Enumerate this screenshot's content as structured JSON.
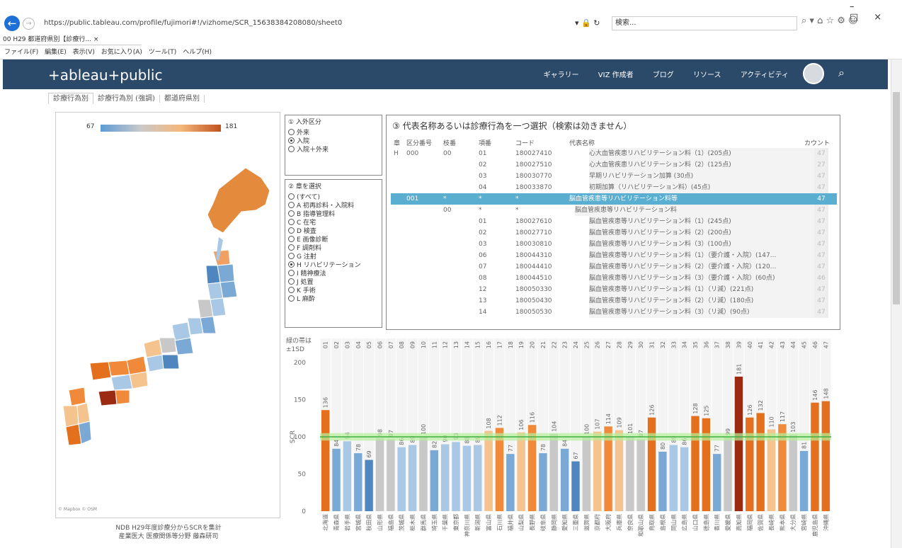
{
  "browser": {
    "url": "https://public.tableau.com/profile/fujimori#!/vizhome/SCR_15638384208080/sheet0",
    "search_placeholder": "検索...",
    "tab_title": "00 H29 都道府県別【診療行...",
    "menu": [
      "ファイル(F)",
      "編集(E)",
      "表示(V)",
      "お気に入り(A)",
      "ツール(T)",
      "ヘルプ(H)"
    ]
  },
  "tableau_nav": {
    "logo": "+ableau+public",
    "links": [
      "ギャラリー",
      "VIZ 作成者",
      "ブログ",
      "リソース",
      "アクティビティ"
    ]
  },
  "viz_tabs": [
    "診療行為別",
    "診療行為別 (強調)",
    "都道府県別"
  ],
  "map": {
    "legend_min": "67",
    "legend_max": "181",
    "attribution": "© Mapbox © OSM",
    "note_line1": "NDB H29年度診療分からSCRを集計",
    "note_line2": "産業医大 医療関係等分野 藤森研司"
  },
  "panel1": {
    "title": "① 入外区分",
    "options": [
      "外来",
      "入院",
      "入院＋外来"
    ],
    "selected": 1
  },
  "panel2": {
    "title": "② 章を選択",
    "options": [
      "(すべて)",
      "A 初再診料・入院料",
      "B 指導管理料",
      "C 在宅",
      "D 検査",
      "E 画像診断",
      "F 調剤料",
      "G 注射",
      "H リハビリテーション",
      "I 精神療法",
      "J 処置",
      "K 手術",
      "L 麻酔"
    ],
    "selected": 8
  },
  "panel3": {
    "title": "③ 代表名称あるいは診療行為を一つ選択（検索は効きません）",
    "headers": [
      "章",
      "区分番号",
      "枝番",
      "項番",
      "コード",
      "代表名称",
      "カウント"
    ],
    "rows": [
      {
        "ch": "H",
        "kubun": "000",
        "eda": "00",
        "kou": "01",
        "code": "180027410",
        "name": "心大血管疾患リハビリテーション料（1）(205点)",
        "cnt": "47"
      },
      {
        "ch": "",
        "kubun": "",
        "eda": "",
        "kou": "02",
        "code": "180027510",
        "name": "心大血管疾患リハビリテーション料（2）(125点)",
        "cnt": "27"
      },
      {
        "ch": "",
        "kubun": "",
        "eda": "",
        "kou": "03",
        "code": "180030770",
        "name": "早期リハビリテーション加算 (30点)",
        "cnt": "47"
      },
      {
        "ch": "",
        "kubun": "",
        "eda": "",
        "kou": "04",
        "code": "180033870",
        "name": "初期加算（リハビリテーション料）(45点)",
        "cnt": "47"
      },
      {
        "ch": "",
        "kubun": "001",
        "eda": "*",
        "kou": "*",
        "code": "*",
        "name": "脳血管疾患等リハビリテーション料等",
        "cnt": "47",
        "hl": true
      },
      {
        "ch": "",
        "kubun": "",
        "eda": "00",
        "kou": "*",
        "code": "*",
        "name": "脳血管疾患等リハビリテーション料",
        "cnt": "47"
      },
      {
        "ch": "",
        "kubun": "",
        "eda": "",
        "kou": "01",
        "code": "180027610",
        "name": "脳血管疾患等リハビリテーション料（1）(245点)",
        "cnt": "47"
      },
      {
        "ch": "",
        "kubun": "",
        "eda": "",
        "kou": "02",
        "code": "180027710",
        "name": "脳血管疾患等リハビリテーション料（2）(200点)",
        "cnt": "47"
      },
      {
        "ch": "",
        "kubun": "",
        "eda": "",
        "kou": "03",
        "code": "180030810",
        "name": "脳血管疾患等リハビリテーション料（3）(100点)",
        "cnt": "47"
      },
      {
        "ch": "",
        "kubun": "",
        "eda": "",
        "kou": "06",
        "code": "180044310",
        "name": "脳血管疾患等リハビリテーション料（1）（要介護・入院）(147...",
        "cnt": "47"
      },
      {
        "ch": "",
        "kubun": "",
        "eda": "",
        "kou": "07",
        "code": "180044410",
        "name": "脳血管疾患等リハビリテーション料（2）（要介護・入院）(120...",
        "cnt": "47"
      },
      {
        "ch": "",
        "kubun": "",
        "eda": "",
        "kou": "08",
        "code": "180044510",
        "name": "脳血管疾患等リハビリテーション料（3）（要介護・入院）(60点)",
        "cnt": "46"
      },
      {
        "ch": "",
        "kubun": "",
        "eda": "",
        "kou": "12",
        "code": "180050330",
        "name": "脳血管疾患等リハビリテーション料（1）（リ減）(221点)",
        "cnt": "47"
      },
      {
        "ch": "",
        "kubun": "",
        "eda": "",
        "kou": "13",
        "code": "180050430",
        "name": "脳血管疾患等リハビリテーション料（2）（リ減）(180点)",
        "cnt": "47"
      },
      {
        "ch": "",
        "kubun": "",
        "eda": "",
        "kou": "14",
        "code": "180050530",
        "name": "脳血管疾患等リハビリテーション料（3）（リ減）(90点)",
        "cnt": "47"
      }
    ]
  },
  "chart_data": {
    "type": "bar",
    "band_label_line1": "緑の帯は",
    "band_label_line2": "±1SD",
    "ylabel": "SCR",
    "ylim": [
      0,
      200
    ],
    "yticks": [
      0,
      50,
      100,
      150,
      200
    ],
    "codes": [
      "01",
      "02",
      "03",
      "04",
      "05",
      "06",
      "07",
      "08",
      "09",
      "10",
      "11",
      "12",
      "13",
      "14",
      "15",
      "16",
      "17",
      "18",
      "19",
      "20",
      "21",
      "22",
      "23",
      "24",
      "25",
      "26",
      "27",
      "28",
      "29",
      "30",
      "31",
      "32",
      "33",
      "34",
      "35",
      "36",
      "37",
      "38",
      "39",
      "40",
      "41",
      "42",
      "43",
      "44",
      "45",
      "46",
      "47"
    ],
    "categories": [
      "北海道",
      "青森県",
      "岩手県",
      "宮城県",
      "秋田県",
      "山形県",
      "福島県",
      "茨城県",
      "栃木県",
      "群馬県",
      "埼玉県",
      "千葉県",
      "東京都",
      "神奈川県",
      "新潟県",
      "富山県",
      "石川県",
      "福井県",
      "山梨県",
      "長野県",
      "岐阜県",
      "静岡県",
      "愛知県",
      "三重県",
      "滋賀県",
      "京都府",
      "大阪府",
      "兵庫県",
      "奈良県",
      "和歌山県",
      "鳥取県",
      "島根県",
      "岡山県",
      "広島県",
      "山口県",
      "徳島県",
      "香川県",
      "愛媛県",
      "高知県",
      "福岡県",
      "佐賀県",
      "長崎県",
      "熊本県",
      "大分県",
      "宮崎県",
      "鹿児島県",
      "沖縄県"
    ],
    "values": [
      136,
      84,
      94,
      78,
      69,
      98,
      97,
      86,
      89,
      100,
      82,
      90,
      93,
      88,
      89,
      108,
      112,
      77,
      106,
      116,
      78,
      104,
      84,
      67,
      100,
      107,
      114,
      109,
      101,
      97,
      126,
      80,
      89,
      86,
      128,
      125,
      77,
      99,
      181,
      126,
      132,
      110,
      117,
      103,
      81,
      146,
      148
    ],
    "band": [
      95,
      105
    ],
    "colors": {
      "dark_blue": "#4f86bf",
      "blue": "#7aa9d6",
      "light_blue": "#a8c8e6",
      "gray": "#c8c8c8",
      "light_orange": "#f5c48e",
      "orange": "#f08a3a",
      "dark_orange": "#e46f1c",
      "darkred": "#9c2a12",
      "band": "#b6f09a",
      "mean_line": "#3cb043"
    }
  }
}
